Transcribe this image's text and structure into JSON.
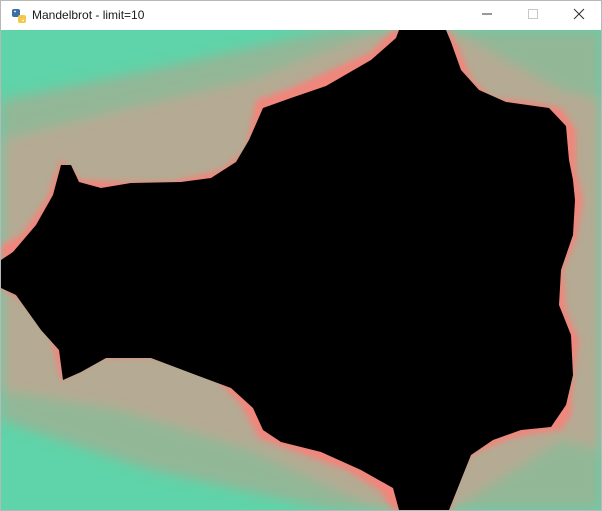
{
  "window": {
    "title": "Mandelbrot - limit=10",
    "app_icon": "python-icon",
    "controls": {
      "minimize_icon": "minimize-icon",
      "maximize_icon": "maximize-icon",
      "close_icon": "close-icon"
    }
  },
  "render": {
    "fractal": "mandelbrot",
    "iteration_limit": 10,
    "set_color": "#000000",
    "outer_color": "#5fd3a9",
    "inner_color": "#f0867c"
  }
}
